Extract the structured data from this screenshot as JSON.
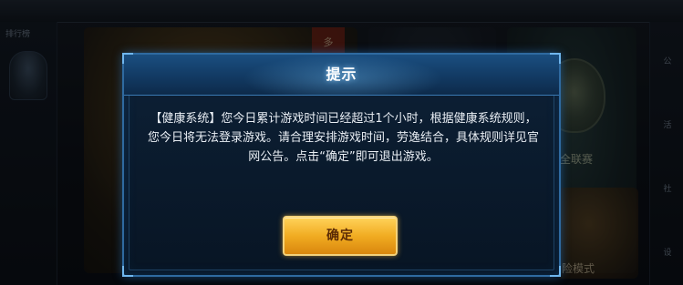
{
  "background": {
    "left_panel_label": "排行榜",
    "card_ribbon": "多",
    "league_label": "全联赛",
    "mode_label": "险模式",
    "right_strip_chars": [
      "公",
      "活",
      "社",
      "设"
    ]
  },
  "dialog": {
    "title": "提示",
    "message": "【健康系统】您今日累计游戏时间已经超过1个小时，根据健康系统规则，您今日将无法登录游戏。请合理安排游戏时间，劳逸结合，具体规则详见官网公告。点击“确定”即可退出游戏。",
    "confirm_label": "确定"
  },
  "colors": {
    "dialog_border": "#2f6aa0",
    "dialog_header": "#123a63",
    "button_gold": "#f1ac22",
    "button_text": "#5a2a06"
  }
}
